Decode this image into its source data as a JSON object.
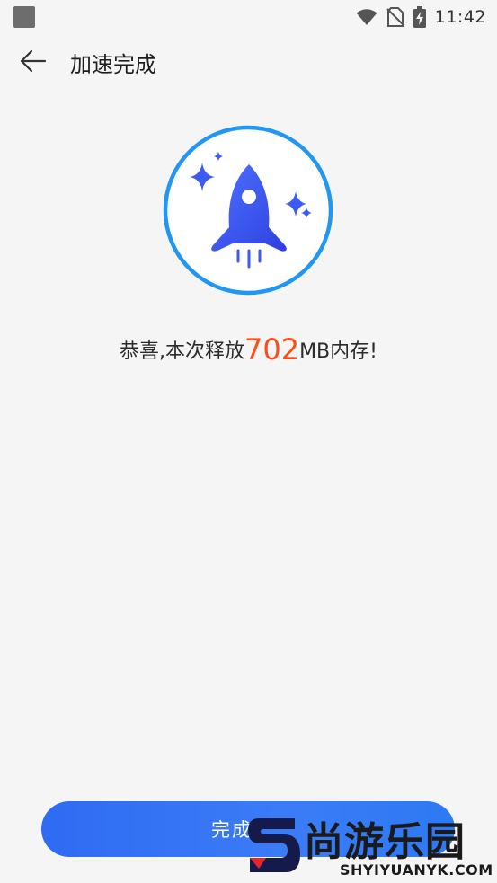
{
  "status_bar": {
    "time": "11:42"
  },
  "header": {
    "title": "加速完成"
  },
  "hero": {
    "icon": "rocket-icon",
    "accent_color": "#2196f3",
    "rocket_color": "#3d5af1"
  },
  "result": {
    "prefix": "恭喜,本次释放",
    "amount": "702",
    "unit": "MB",
    "suffix": "内存!"
  },
  "footer": {
    "done_label": "完成"
  },
  "watermark": {
    "text": "尚游乐园",
    "sub": "SHYIYUANYK.COM"
  },
  "colors": {
    "background": "#f5f5f5",
    "highlight": "#ff4c1b",
    "button": "#3377f5"
  }
}
